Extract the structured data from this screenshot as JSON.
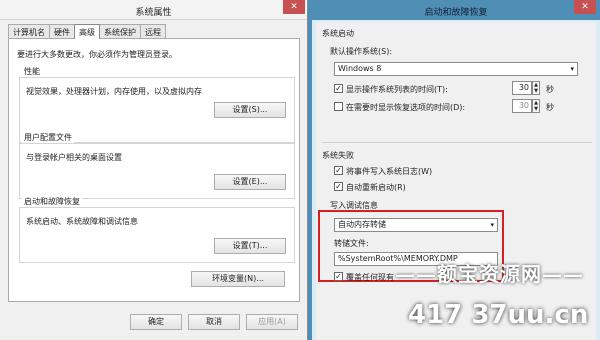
{
  "left_window": {
    "title": "系统属性",
    "close_glyph": "✕",
    "tabs": [
      "计算机名",
      "硬件",
      "高级",
      "系统保护",
      "远程"
    ],
    "hint": "要进行大多数更改，你必须作为管理员登录。",
    "groups": [
      {
        "title": "性能",
        "desc": "视觉效果，处理器计划，内存使用，以及虚拟内存",
        "button": "设置(S)..."
      },
      {
        "title": "用户配置文件",
        "desc": "与登录帐户相关的桌面设置",
        "button": "设置(E)..."
      },
      {
        "title": "启动和故障恢复",
        "desc": "系统启动、系统故障和调试信息",
        "button": "设置(T)..."
      }
    ],
    "env_button": "环境变量(N)...",
    "ok": "确定",
    "cancel": "取消",
    "apply": "应用(A)"
  },
  "right_window": {
    "title": "启动和故障恢复",
    "close_glyph": "✕",
    "startup_header": "系统启动",
    "default_os_label": "默认操作系统(S):",
    "default_os_value": "Windows 8",
    "show_os_list": {
      "label": "显示操作系统列表的时间(T):",
      "checked": true,
      "value": "30",
      "unit": "秒"
    },
    "show_recovery": {
      "label": "在需要时显示恢复选项的时间(D):",
      "checked": false,
      "value": "30",
      "unit": "秒"
    },
    "failure_header": "系统失败",
    "write_log": {
      "label": "将事件写入系统日志(W)",
      "checked": true
    },
    "auto_restart": {
      "label": "自动重新启动(R)",
      "checked": true
    },
    "debug_header": "写入调试信息",
    "debug_type": "自动内存转储",
    "dump_file_label": "转储文件:",
    "dump_file_value": "%SystemRoot%\\MEMORY.DMP",
    "overwrite": {
      "label": "覆盖任何现有",
      "checked": true
    },
    "check_mark": "✓",
    "arrow_down": "▾",
    "spin_up": "▲",
    "spin_down": "▼"
  },
  "watermark": {
    "line1": "——额宝资源网——",
    "line2": "417 37uu.cn"
  },
  "colors": {
    "highlight_box": "#d42020",
    "title_bar_active": "#4f8fb6",
    "close_button": "#c75050"
  }
}
